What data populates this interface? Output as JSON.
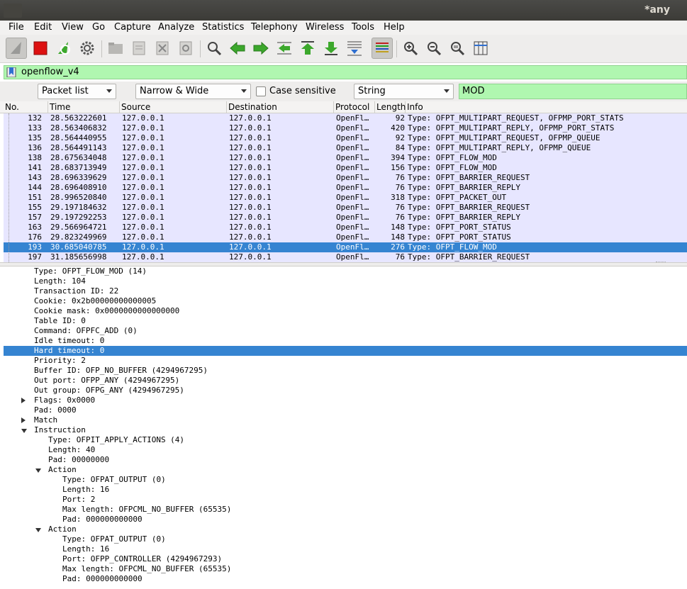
{
  "window": {
    "title": "*any"
  },
  "menu": [
    "File",
    "Edit",
    "View",
    "Go",
    "Capture",
    "Analyze",
    "Statistics",
    "Telephony",
    "Wireless",
    "Tools",
    "Help"
  ],
  "filter": {
    "value": "openflow_v4"
  },
  "find": {
    "scope": "Packet list",
    "width_mode": "Narrow & Wide",
    "case_sensitive_label": "Case sensitive",
    "search_type": "String",
    "query": "MOD"
  },
  "columns": [
    "No.",
    "Time",
    "Source",
    "Destination",
    "Protocol",
    "Length",
    "Info"
  ],
  "packets": [
    {
      "no": "132",
      "time": "28.563222601",
      "src": "127.0.0.1",
      "dst": "127.0.0.1",
      "proto": "OpenFl…",
      "len": "92",
      "info": "Type: OFPT_MULTIPART_REQUEST, OFPMP_PORT_STATS"
    },
    {
      "no": "133",
      "time": "28.563406832",
      "src": "127.0.0.1",
      "dst": "127.0.0.1",
      "proto": "OpenFl…",
      "len": "420",
      "info": "Type: OFPT_MULTIPART_REPLY, OFPMP_PORT_STATS"
    },
    {
      "no": "135",
      "time": "28.564440955",
      "src": "127.0.0.1",
      "dst": "127.0.0.1",
      "proto": "OpenFl…",
      "len": "92",
      "info": "Type: OFPT_MULTIPART_REQUEST, OFPMP_QUEUE"
    },
    {
      "no": "136",
      "time": "28.564491143",
      "src": "127.0.0.1",
      "dst": "127.0.0.1",
      "proto": "OpenFl…",
      "len": "84",
      "info": "Type: OFPT_MULTIPART_REPLY, OFPMP_QUEUE"
    },
    {
      "no": "138",
      "time": "28.675634048",
      "src": "127.0.0.1",
      "dst": "127.0.0.1",
      "proto": "OpenFl…",
      "len": "394",
      "info": "Type: OFPT_FLOW_MOD"
    },
    {
      "no": "141",
      "time": "28.683713949",
      "src": "127.0.0.1",
      "dst": "127.0.0.1",
      "proto": "OpenFl…",
      "len": "156",
      "info": "Type: OFPT_FLOW_MOD"
    },
    {
      "no": "143",
      "time": "28.696339629",
      "src": "127.0.0.1",
      "dst": "127.0.0.1",
      "proto": "OpenFl…",
      "len": "76",
      "info": "Type: OFPT_BARRIER_REQUEST"
    },
    {
      "no": "144",
      "time": "28.696408910",
      "src": "127.0.0.1",
      "dst": "127.0.0.1",
      "proto": "OpenFl…",
      "len": "76",
      "info": "Type: OFPT_BARRIER_REPLY"
    },
    {
      "no": "151",
      "time": "28.996520840",
      "src": "127.0.0.1",
      "dst": "127.0.0.1",
      "proto": "OpenFl…",
      "len": "318",
      "info": "Type: OFPT_PACKET_OUT"
    },
    {
      "no": "155",
      "time": "29.197184632",
      "src": "127.0.0.1",
      "dst": "127.0.0.1",
      "proto": "OpenFl…",
      "len": "76",
      "info": "Type: OFPT_BARRIER_REQUEST"
    },
    {
      "no": "157",
      "time": "29.197292253",
      "src": "127.0.0.1",
      "dst": "127.0.0.1",
      "proto": "OpenFl…",
      "len": "76",
      "info": "Type: OFPT_BARRIER_REPLY"
    },
    {
      "no": "163",
      "time": "29.566964721",
      "src": "127.0.0.1",
      "dst": "127.0.0.1",
      "proto": "OpenFl…",
      "len": "148",
      "info": "Type: OFPT_PORT_STATUS"
    },
    {
      "no": "176",
      "time": "29.823249969",
      "src": "127.0.0.1",
      "dst": "127.0.0.1",
      "proto": "OpenFl…",
      "len": "148",
      "info": "Type: OFPT_PORT_STATUS"
    },
    {
      "no": "193",
      "time": "30.685040785",
      "src": "127.0.0.1",
      "dst": "127.0.0.1",
      "proto": "OpenFl…",
      "len": "276",
      "info": "Type: OFPT_FLOW_MOD"
    },
    {
      "no": "197",
      "time": "31.185656998",
      "src": "127.0.0.1",
      "dst": "127.0.0.1",
      "proto": "OpenFl…",
      "len": "76",
      "info": "Type: OFPT_BARRIER_REQUEST"
    }
  ],
  "selected_packet": "193",
  "details": [
    {
      "text": "Type: OFPT_FLOW_MOD (14)",
      "level": 0,
      "expander": "none"
    },
    {
      "text": "Length: 104",
      "level": 0,
      "expander": "none"
    },
    {
      "text": "Transaction ID: 22",
      "level": 0,
      "expander": "none"
    },
    {
      "text": "Cookie: 0x2b00000000000005",
      "level": 0,
      "expander": "none"
    },
    {
      "text": "Cookie mask: 0x0000000000000000",
      "level": 0,
      "expander": "none"
    },
    {
      "text": "Table ID: 0",
      "level": 0,
      "expander": "none"
    },
    {
      "text": "Command: OFPFC_ADD (0)",
      "level": 0,
      "expander": "none"
    },
    {
      "text": "Idle timeout: 0",
      "level": 0,
      "expander": "none"
    },
    {
      "text": "Hard timeout: 0",
      "level": 0,
      "expander": "none",
      "selected": true
    },
    {
      "text": "Priority: 2",
      "level": 0,
      "expander": "none"
    },
    {
      "text": "Buffer ID: OFP_NO_BUFFER (4294967295)",
      "level": 0,
      "expander": "none"
    },
    {
      "text": "Out port: OFPP_ANY (4294967295)",
      "level": 0,
      "expander": "none"
    },
    {
      "text": "Out group: OFPG_ANY (4294967295)",
      "level": 0,
      "expander": "none"
    },
    {
      "text": "Flags: 0x0000",
      "level": 0,
      "expander": "collapsed"
    },
    {
      "text": "Pad: 0000",
      "level": 0,
      "expander": "none"
    },
    {
      "text": "Match",
      "level": 0,
      "expander": "collapsed"
    },
    {
      "text": "Instruction",
      "level": 0,
      "expander": "expanded"
    },
    {
      "text": "Type: OFPIT_APPLY_ACTIONS (4)",
      "level": 1,
      "expander": "none"
    },
    {
      "text": "Length: 40",
      "level": 1,
      "expander": "none"
    },
    {
      "text": "Pad: 00000000",
      "level": 1,
      "expander": "none"
    },
    {
      "text": "Action",
      "level": 1,
      "expander": "expanded"
    },
    {
      "text": "Type: OFPAT_OUTPUT (0)",
      "level": 2,
      "expander": "none"
    },
    {
      "text": "Length: 16",
      "level": 2,
      "expander": "none"
    },
    {
      "text": "Port: 2",
      "level": 2,
      "expander": "none"
    },
    {
      "text": "Max length: OFPCML_NO_BUFFER (65535)",
      "level": 2,
      "expander": "none"
    },
    {
      "text": "Pad: 000000000000",
      "level": 2,
      "expander": "none"
    },
    {
      "text": "Action",
      "level": 1,
      "expander": "expanded"
    },
    {
      "text": "Type: OFPAT_OUTPUT (0)",
      "level": 2,
      "expander": "none"
    },
    {
      "text": "Length: 16",
      "level": 2,
      "expander": "none"
    },
    {
      "text": "Port: OFPP_CONTROLLER (4294967293)",
      "level": 2,
      "expander": "none"
    },
    {
      "text": "Max length: OFPCML_NO_BUFFER (65535)",
      "level": 2,
      "expander": "none"
    },
    {
      "text": "Pad: 000000000000",
      "level": 2,
      "expander": "none"
    }
  ],
  "icons": [
    "shark-fin-icon",
    "stop-icon",
    "restart-icon",
    "options-gear-icon",
    "open-folder-icon",
    "save-icon",
    "close-file-icon",
    "reload-icon",
    "find-icon",
    "back-arrow-icon",
    "forward-arrow-icon",
    "goto-packet-icon",
    "first-packet-icon",
    "last-packet-icon",
    "autoscroll-icon",
    "colorize-icon",
    "zoom-in-icon",
    "zoom-out-icon",
    "zoom-normal-icon",
    "resize-columns-icon"
  ],
  "colors": {
    "filter_ok": "#b0f7b0",
    "selection": "#3584d1",
    "row_bg": "#e7e6ff",
    "stop_red": "#dd1111",
    "arrow_green": "#3ca82c"
  }
}
